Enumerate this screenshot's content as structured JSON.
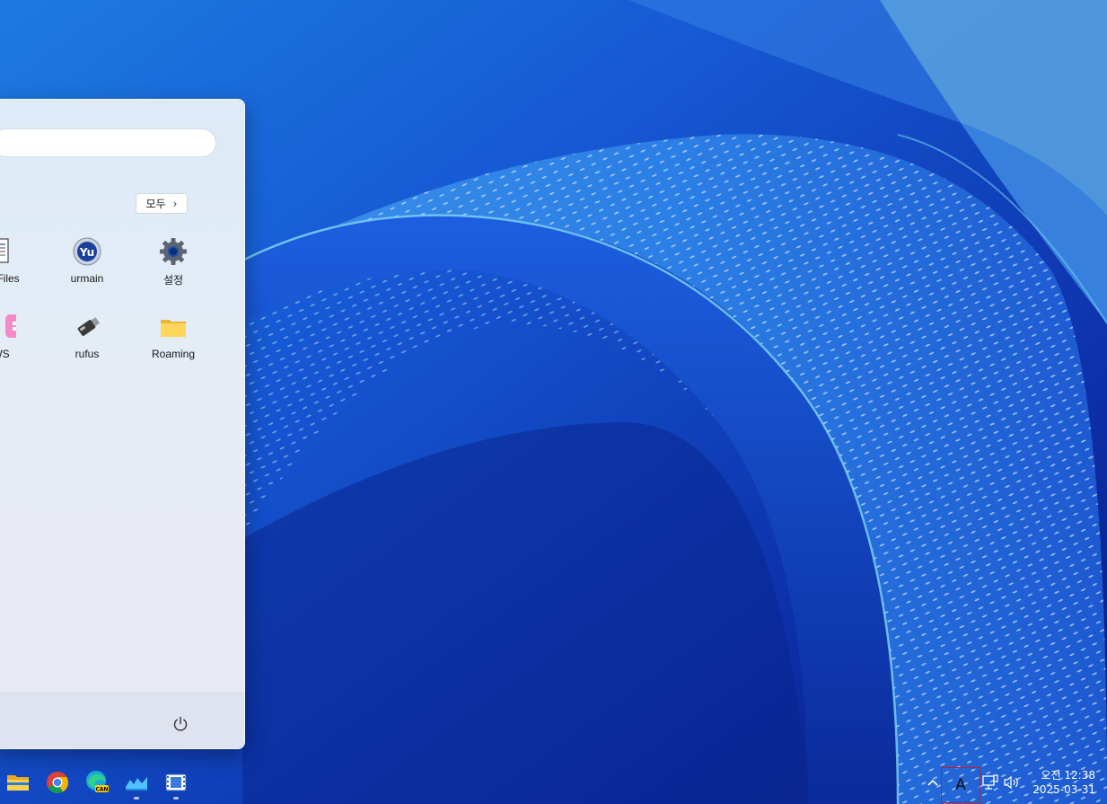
{
  "start_menu": {
    "all_button_label": "모두",
    "pinned_apps": [
      {
        "label": "MyFiles",
        "icon": "document-icon"
      },
      {
        "label": "urmain",
        "icon": "yu-logo-icon"
      },
      {
        "label": "설정",
        "icon": "gear-icon"
      },
      {
        "label": "WS",
        "icon": "windows-logo-icon"
      },
      {
        "label": "rufus",
        "icon": "usb-drive-icon"
      },
      {
        "label": "Roaming",
        "icon": "folder-icon"
      }
    ]
  },
  "taskbar": {
    "apps": [
      {
        "name": "file-explorer",
        "icon": "folder-icon"
      },
      {
        "name": "chrome",
        "icon": "chrome-icon"
      },
      {
        "name": "edge-can",
        "icon": "edge-icon",
        "badge": "CAN"
      },
      {
        "name": "cloud-app",
        "icon": "cloud-wave-icon"
      },
      {
        "name": "media-app",
        "icon": "film-icon"
      }
    ],
    "ime_label": "A",
    "clock_time": "오전 12:38",
    "clock_date": "2025-03-31"
  }
}
